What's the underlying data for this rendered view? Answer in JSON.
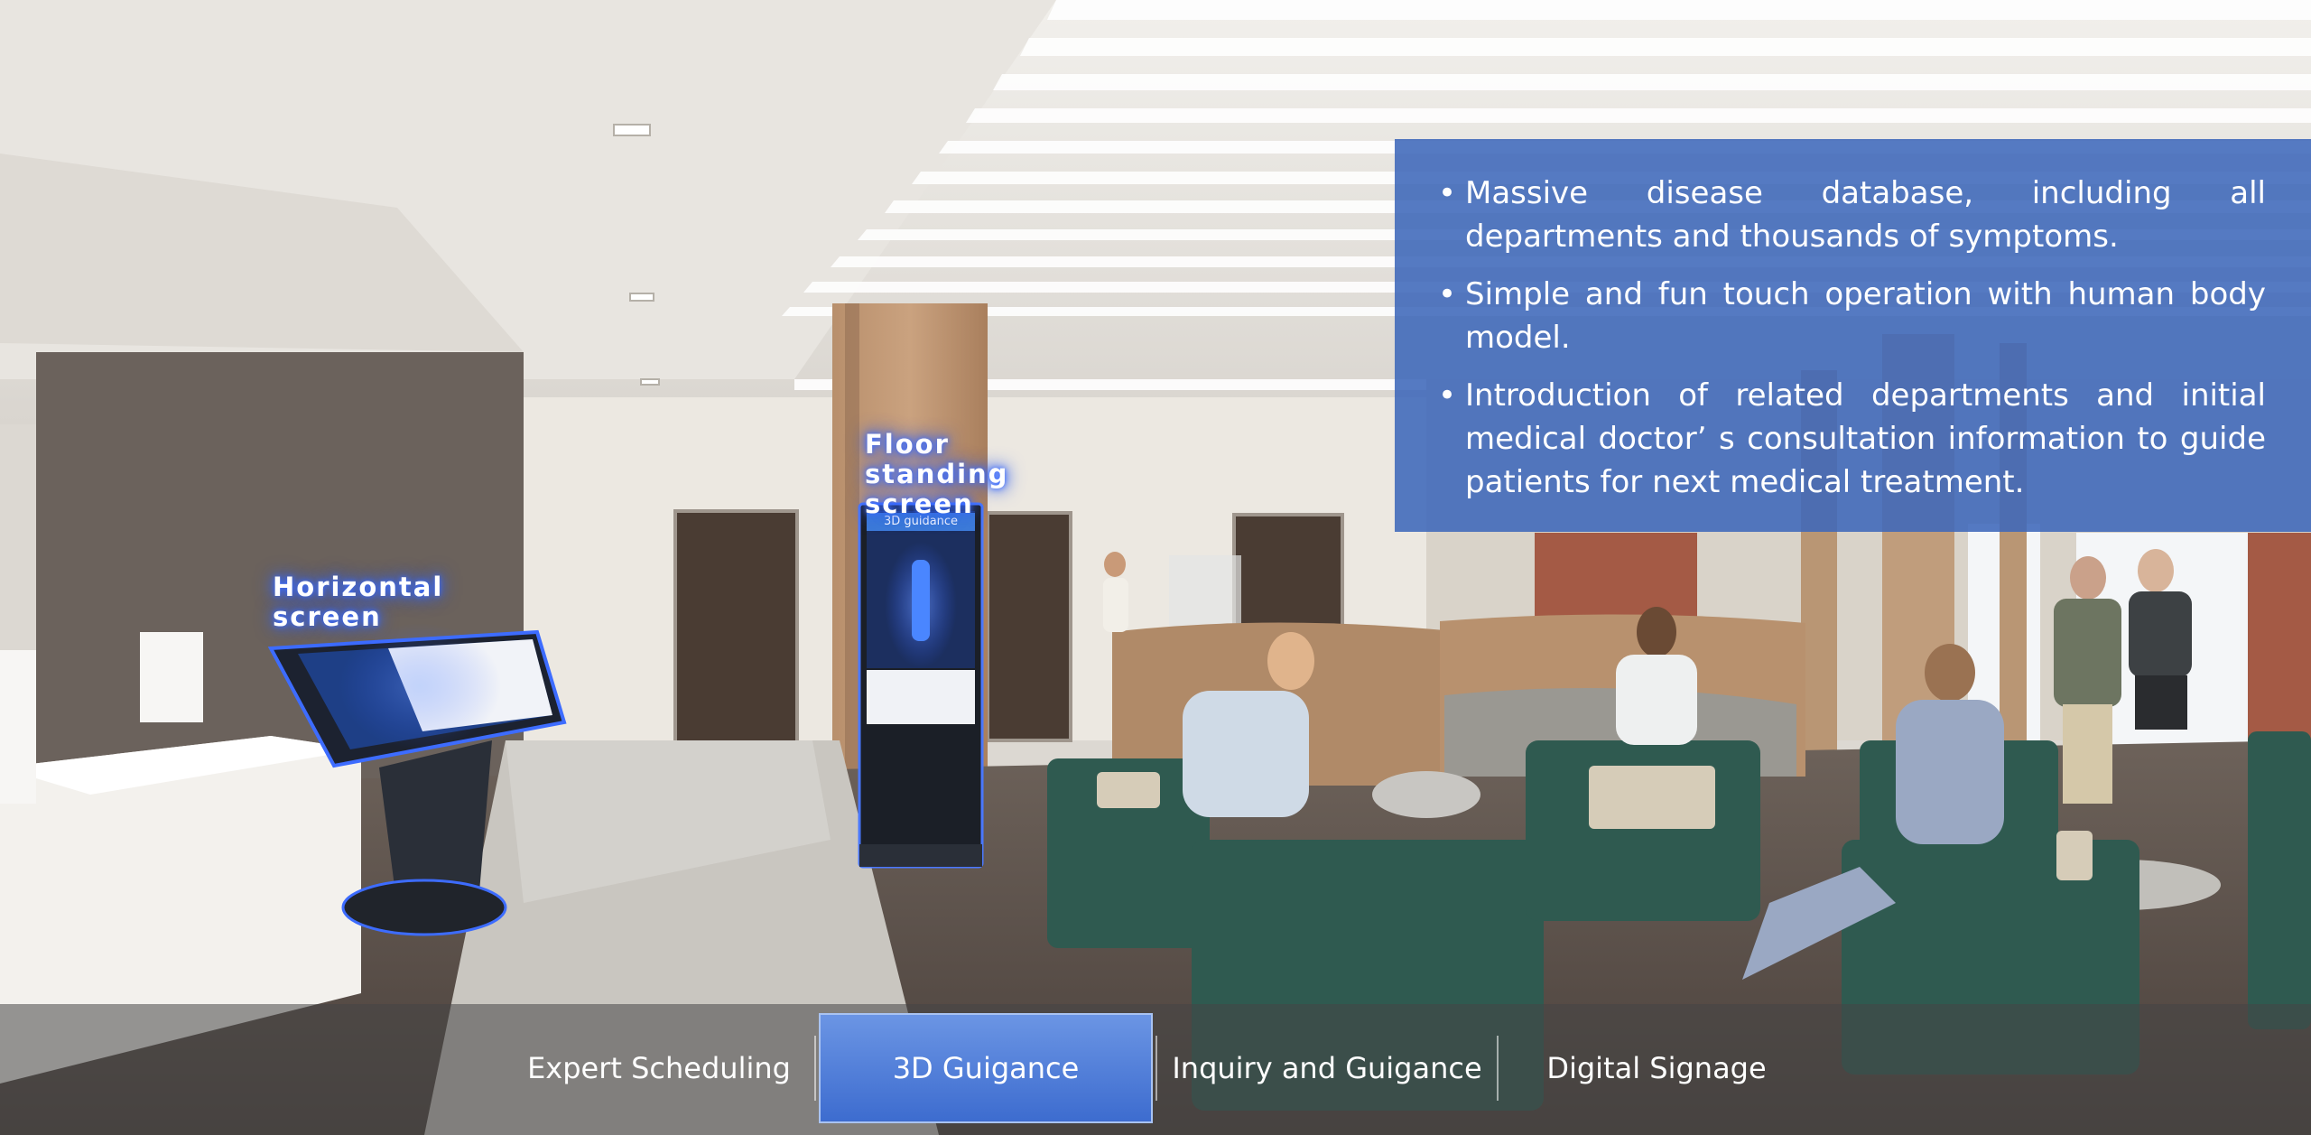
{
  "labels": {
    "floor_standing": "Floor standing screen",
    "horizontal": "Horizontal screen"
  },
  "kiosk": {
    "header": "3D guidance"
  },
  "info_panel": {
    "bullets": [
      "Massive disease database, including all departments and thousands of symptoms.",
      "Simple and fun touch operation with human body model.",
      "Introduction of related departments and initial medical doctor’ s consultation information to guide patients for next medical treatment."
    ]
  },
  "tabs": [
    {
      "label": "Expert Scheduling",
      "active": false
    },
    {
      "label": "3D Guigance",
      "active": true
    },
    {
      "label": "Inquiry and Guigance",
      "active": false
    },
    {
      "label": "Digital Signage",
      "active": false
    }
  ],
  "colors": {
    "panel": "#3d68ba",
    "active_tab": "#4f7ed9",
    "glow": "#3b6cff"
  }
}
